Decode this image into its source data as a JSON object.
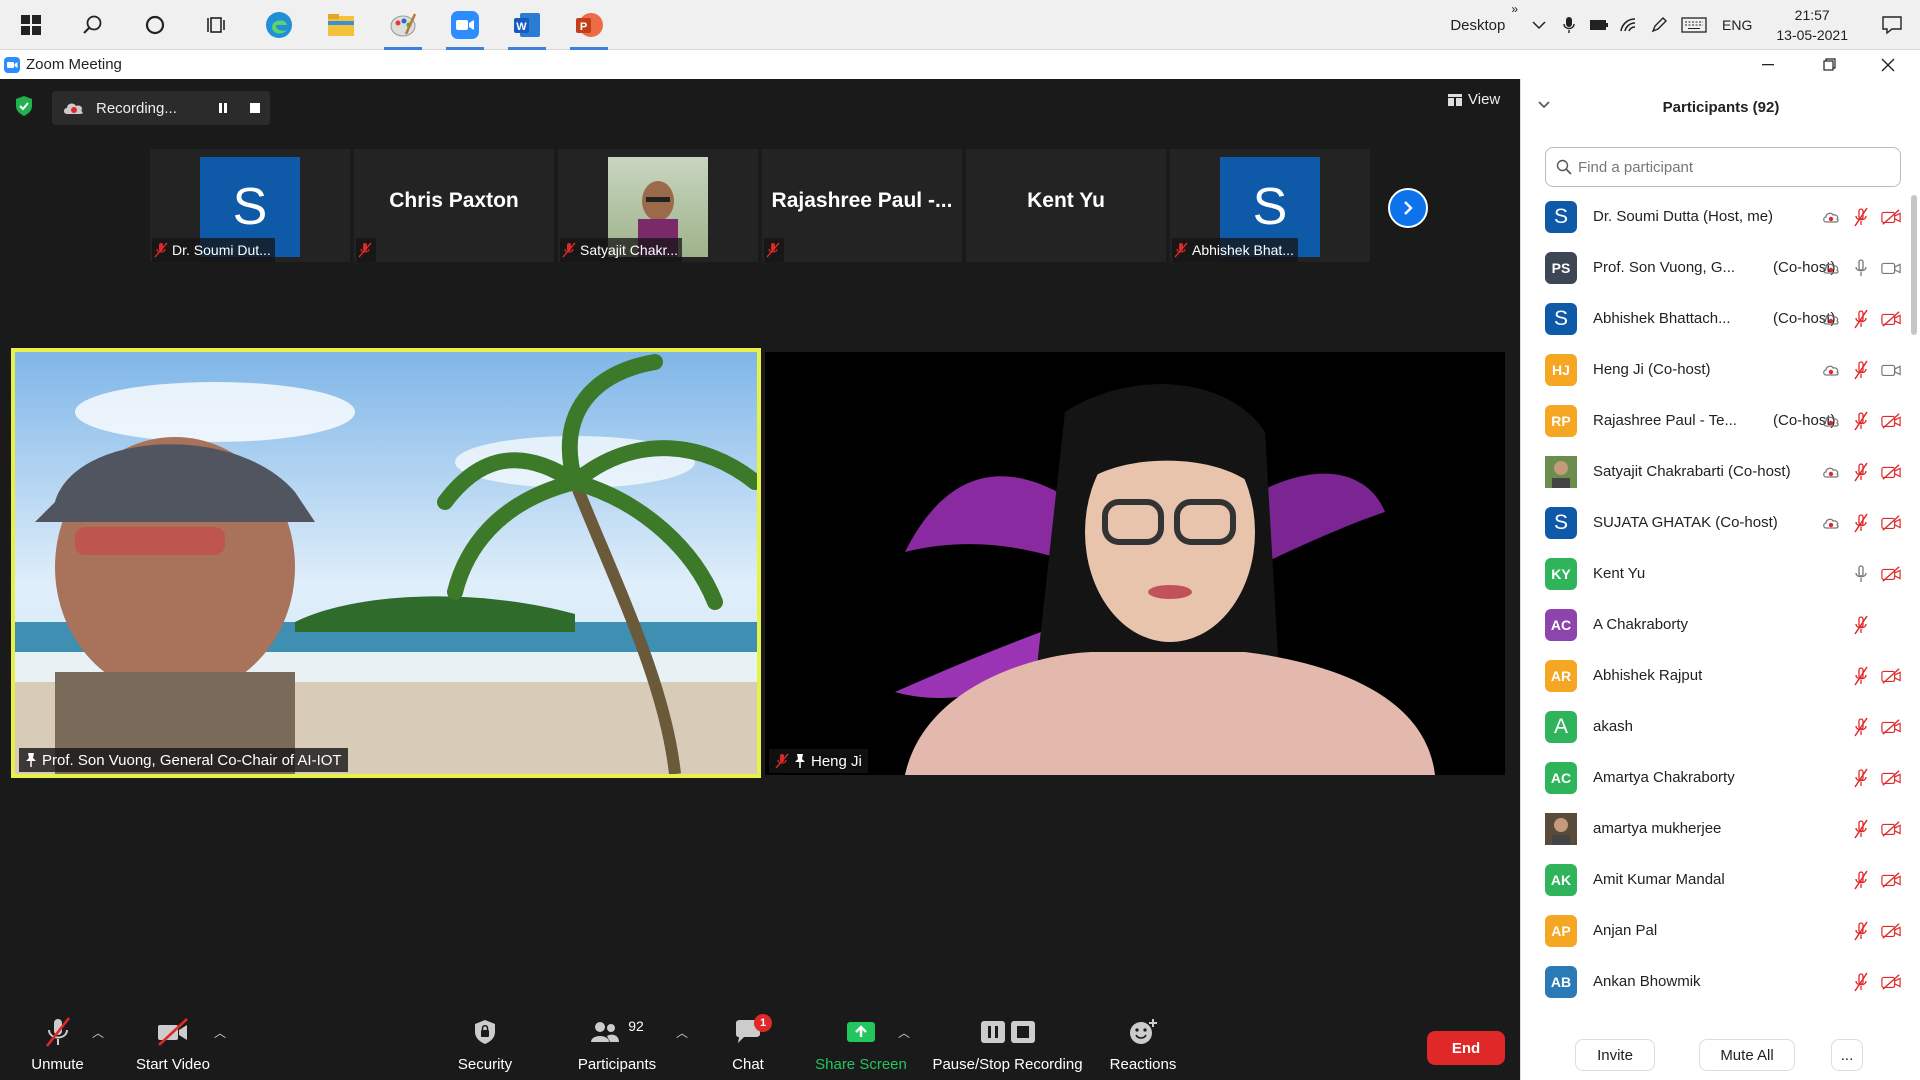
{
  "taskbar": {
    "desktop_label": "Desktop",
    "expand_glyph": "»",
    "lang": "ENG",
    "time": "21:57",
    "date": "13-05-2021"
  },
  "window": {
    "title": "Zoom Meeting"
  },
  "meeting": {
    "recording_label": "Recording...",
    "view_label": "View",
    "strip": [
      {
        "kind": "avatar",
        "initial": "S",
        "label": "Dr. Soumi Dut..."
      },
      {
        "kind": "name",
        "big_name": "Chris Paxton",
        "label": ""
      },
      {
        "kind": "photo",
        "label": "Satyajit Chakr..."
      },
      {
        "kind": "name",
        "big_name": "Rajashree  Paul  -...",
        "label": ""
      },
      {
        "kind": "name",
        "big_name": "Kent Yu",
        "label": ""
      },
      {
        "kind": "avatar",
        "initial": "S",
        "label": "Abhishek Bhat..."
      }
    ],
    "main_videos": [
      {
        "label": "Prof. Son Vuong, General Co-Chair of AI-IOT"
      },
      {
        "label": "Heng Ji"
      }
    ]
  },
  "toolbar": {
    "unmute": "Unmute",
    "start_video": "Start Video",
    "security": "Security",
    "participants": "Participants",
    "participants_count": "92",
    "chat": "Chat",
    "chat_badge": "1",
    "share_screen": "Share Screen",
    "pause_stop_recording": "Pause/Stop Recording",
    "reactions": "Reactions",
    "end": "End",
    "colors": {
      "share": "#22c55e",
      "end": "#e02828",
      "badge": "#e02828"
    }
  },
  "panel": {
    "title": "Participants (92)",
    "search_placeholder": "Find a participant",
    "invite": "Invite",
    "mute_all": "Mute All",
    "more": "...",
    "participants": [
      {
        "initials": "S",
        "color": "#0e5aa8",
        "name": "Dr. Soumi Dutta (Host, me)",
        "role": "",
        "rec": true,
        "mic": "muted",
        "cam": "off"
      },
      {
        "initials": "PS",
        "color": "#3d4654",
        "name": "Prof. Son Vuong, G...",
        "role": "(Co-host)",
        "rec": true,
        "mic": "on",
        "cam": "on"
      },
      {
        "initials": "S",
        "color": "#0e5aa8",
        "name": "Abhishek Bhattach...",
        "role": "(Co-host)",
        "rec": true,
        "mic": "muted",
        "cam": "off"
      },
      {
        "initials": "HJ",
        "color": "#f5a623",
        "name": "Heng Ji (Co-host)",
        "role": "",
        "rec": true,
        "mic": "muted",
        "cam": "on"
      },
      {
        "initials": "RP",
        "color": "#f5a623",
        "name": "Rajashree Paul - Te...",
        "role": "(Co-host)",
        "rec": true,
        "mic": "muted",
        "cam": "off"
      },
      {
        "initials": "",
        "color": "#6b8e4e",
        "name": "Satyajit Chakrabarti (Co-host)",
        "role": "",
        "rec": true,
        "mic": "muted",
        "cam": "off"
      },
      {
        "initials": "S",
        "color": "#0e5aa8",
        "name": "SUJATA GHATAK (Co-host)",
        "role": "",
        "rec": true,
        "mic": "muted",
        "cam": "off"
      },
      {
        "initials": "KY",
        "color": "#2fb35b",
        "name": "Kent Yu",
        "role": "",
        "rec": false,
        "mic": "on",
        "cam": "off"
      },
      {
        "initials": "AC",
        "color": "#8e44ad",
        "name": "A Chakraborty",
        "role": "",
        "rec": false,
        "mic": "muted",
        "cam": "none"
      },
      {
        "initials": "AR",
        "color": "#f5a623",
        "name": "Abhishek Rajput",
        "role": "",
        "rec": false,
        "mic": "muted",
        "cam": "off"
      },
      {
        "initials": "A",
        "color": "#2fb35b",
        "name": "akash",
        "role": "",
        "rec": false,
        "mic": "muted",
        "cam": "off"
      },
      {
        "initials": "AC",
        "color": "#2fb35b",
        "name": "Amartya Chakraborty",
        "role": "",
        "rec": false,
        "mic": "muted",
        "cam": "off"
      },
      {
        "initials": "",
        "color": "#5a4a3a",
        "name": "amartya mukherjee",
        "role": "",
        "rec": false,
        "mic": "muted",
        "cam": "off"
      },
      {
        "initials": "AK",
        "color": "#2fb35b",
        "name": "Amit Kumar Mandal",
        "role": "",
        "rec": false,
        "mic": "muted",
        "cam": "off"
      },
      {
        "initials": "AP",
        "color": "#f5a623",
        "name": "Anjan Pal",
        "role": "",
        "rec": false,
        "mic": "muted",
        "cam": "off"
      },
      {
        "initials": "AB",
        "color": "#2a7ab8",
        "name": "Ankan Bhowmik",
        "role": "",
        "rec": false,
        "mic": "muted",
        "cam": "off"
      }
    ]
  }
}
